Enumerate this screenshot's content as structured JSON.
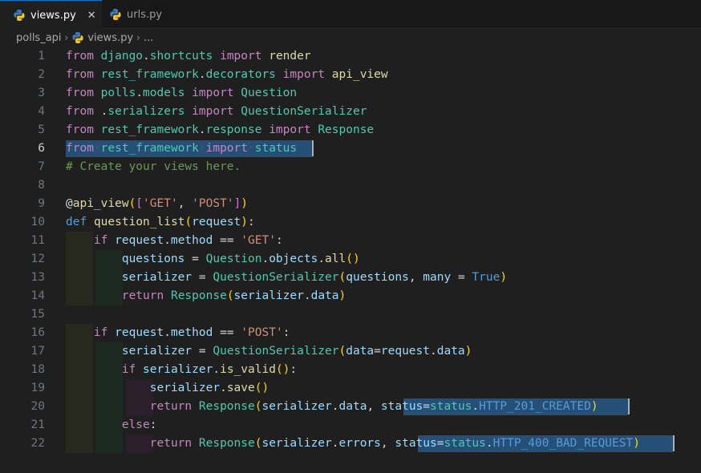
{
  "tabs": [
    {
      "label": "views.py",
      "active": true,
      "close": "✕"
    },
    {
      "label": "urls.py",
      "active": false
    }
  ],
  "breadcrumb": {
    "folder": "polls_api",
    "file": "views.py",
    "tail": "..."
  },
  "editor": {
    "current_line": 6,
    "line_numbers": [
      "1",
      "2",
      "3",
      "4",
      "5",
      "6",
      "7",
      "8",
      "9",
      "10",
      "11",
      "12",
      "13",
      "14",
      "15",
      "16",
      "17",
      "18",
      "19",
      "20",
      "21",
      "22"
    ],
    "lines": [
      "from django.shortcuts import render",
      "from rest_framework.decorators import api_view",
      "from polls.models import Question",
      "from .serializers import QuestionSerializer",
      "from rest_framework.response import Response",
      "from rest_framework import status",
      "# Create your views here.",
      "",
      "@api_view(['GET', 'POST'])",
      "def question_list(request):",
      "    if request.method == 'GET':",
      "        questions = Question.objects.all()",
      "        serializer = QuestionSerializer(questions, many = True)",
      "        return Response(serializer.data)",
      "",
      "    if request.method == 'POST':",
      "        serializer = QuestionSerializer(data=request.data)",
      "        if serializer.is_valid():",
      "            serializer.save()",
      "            return Response(serializer.data, status=status.HTTP_201_CREATED)",
      "        else:",
      "            return Response(serializer.errors, status=status.HTTP_400_BAD_REQUEST)"
    ]
  },
  "colors": {
    "keyword": "#c586c0",
    "storage": "#569cd6",
    "module": "#4ec9b0",
    "function": "#dcdcaa",
    "variable": "#9cdcfe",
    "string": "#ce9178",
    "comment": "#6a9955",
    "selection": "#264f78"
  }
}
